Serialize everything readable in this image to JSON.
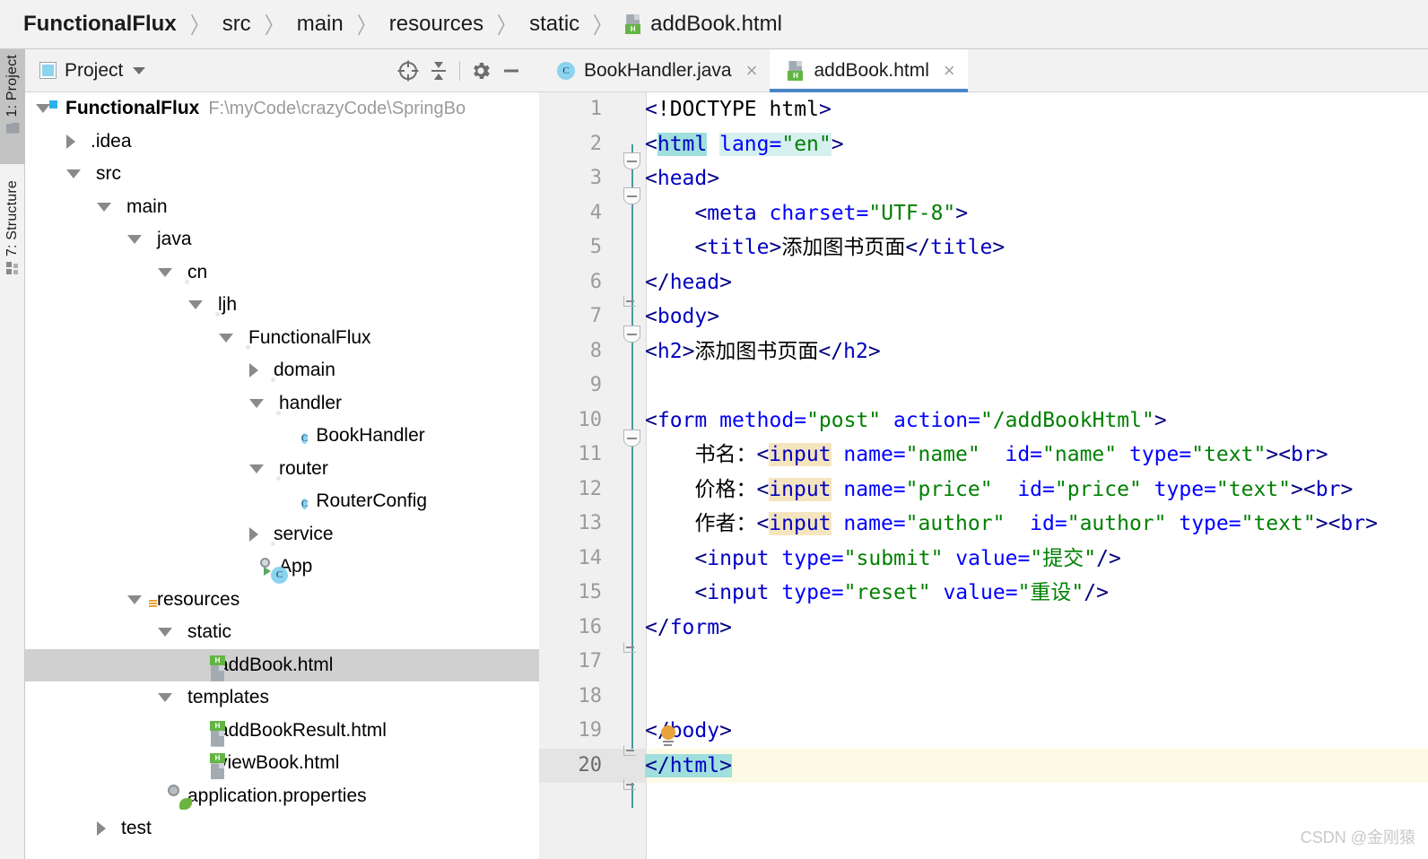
{
  "breadcrumb": {
    "items": [
      "FunctionalFlux",
      "src",
      "main",
      "resources",
      "static"
    ],
    "file": "addBook.html",
    "separator": "〉"
  },
  "left_tool_strip": {
    "tabs": [
      {
        "label": "1: Project",
        "icon": "folder-icon",
        "active": true
      },
      {
        "label": "7: Structure",
        "icon": "structure-icon",
        "active": false
      }
    ]
  },
  "project_panel": {
    "title": "Project",
    "toolbar": {
      "select_opened_file": "crosshair-icon",
      "collapse_all": "collapse-all-icon",
      "settings": "gear-icon",
      "hide": "minus-icon"
    },
    "tree": [
      {
        "depth": 0,
        "twist": "open",
        "icon": "module-folder-icon",
        "label": "FunctionalFlux",
        "bold": true,
        "path": "F:\\myCode\\crazyCode\\SpringBo",
        "selected": false
      },
      {
        "depth": 1,
        "twist": "closed",
        "icon": "folder-icon",
        "label": ".idea",
        "bold": false,
        "path": "",
        "selected": false
      },
      {
        "depth": 1,
        "twist": "open",
        "icon": "folder-icon",
        "label": "src",
        "bold": false,
        "path": "",
        "selected": false
      },
      {
        "depth": 2,
        "twist": "open",
        "icon": "folder-icon",
        "label": "main",
        "bold": false,
        "path": "",
        "selected": false
      },
      {
        "depth": 3,
        "twist": "open",
        "icon": "source-folder-icon",
        "label": "java",
        "bold": false,
        "path": "",
        "selected": false
      },
      {
        "depth": 4,
        "twist": "open",
        "icon": "package-icon",
        "label": "cn",
        "bold": false,
        "path": "",
        "selected": false
      },
      {
        "depth": 5,
        "twist": "open",
        "icon": "package-icon",
        "label": "ljh",
        "bold": false,
        "path": "",
        "selected": false
      },
      {
        "depth": 6,
        "twist": "open",
        "icon": "package-icon",
        "label": "FunctionalFlux",
        "bold": false,
        "path": "",
        "selected": false
      },
      {
        "depth": 7,
        "twist": "closed",
        "icon": "package-icon",
        "label": "domain",
        "bold": false,
        "path": "",
        "selected": false
      },
      {
        "depth": 7,
        "twist": "open",
        "icon": "package-icon",
        "label": "handler",
        "bold": false,
        "path": "",
        "selected": false
      },
      {
        "depth": 8,
        "twist": "none",
        "icon": "java-class-icon",
        "label": "BookHandler",
        "bold": false,
        "path": "",
        "selected": false
      },
      {
        "depth": 7,
        "twist": "open",
        "icon": "package-icon",
        "label": "router",
        "bold": false,
        "path": "",
        "selected": false
      },
      {
        "depth": 8,
        "twist": "none",
        "icon": "java-class-icon",
        "label": "RouterConfig",
        "bold": false,
        "path": "",
        "selected": false
      },
      {
        "depth": 7,
        "twist": "closed",
        "icon": "package-icon",
        "label": "service",
        "bold": false,
        "path": "",
        "selected": false
      },
      {
        "depth": 7,
        "twist": "none",
        "icon": "runnable-class-icon",
        "label": "App",
        "bold": false,
        "path": "",
        "selected": false
      },
      {
        "depth": 3,
        "twist": "open",
        "icon": "resources-folder-icon",
        "label": "resources",
        "bold": false,
        "path": "",
        "selected": false
      },
      {
        "depth": 4,
        "twist": "open",
        "icon": "folder-icon",
        "label": "static",
        "bold": false,
        "path": "",
        "selected": false
      },
      {
        "depth": 5,
        "twist": "none",
        "icon": "html-file-icon",
        "label": "addBook.html",
        "bold": false,
        "path": "",
        "selected": true
      },
      {
        "depth": 4,
        "twist": "open",
        "icon": "folder-icon",
        "label": "templates",
        "bold": false,
        "path": "",
        "selected": false
      },
      {
        "depth": 5,
        "twist": "none",
        "icon": "html-file-icon",
        "label": "addBookResult.html",
        "bold": false,
        "path": "",
        "selected": false
      },
      {
        "depth": 5,
        "twist": "none",
        "icon": "html-file-icon",
        "label": "viewBook.html",
        "bold": false,
        "path": "",
        "selected": false
      },
      {
        "depth": 4,
        "twist": "none",
        "icon": "spring-properties-icon",
        "label": "application.properties",
        "bold": false,
        "path": "",
        "selected": false
      },
      {
        "depth": 2,
        "twist": "closed",
        "icon": "folder-icon",
        "label": "test",
        "bold": false,
        "path": "",
        "selected": false
      }
    ]
  },
  "editor": {
    "tabs": [
      {
        "label": "BookHandler.java",
        "icon": "java-class-icon",
        "active": false,
        "close": "×"
      },
      {
        "label": "addBook.html",
        "icon": "html-file-icon",
        "active": true,
        "close": "×"
      }
    ],
    "language": "HTML",
    "total_lines": 20,
    "current_line": 20,
    "code_lines": [
      {
        "n": 1,
        "text": "<!DOCTYPE html>"
      },
      {
        "n": 2,
        "text": "<html lang=\"en\">"
      },
      {
        "n": 3,
        "text": "<head>"
      },
      {
        "n": 4,
        "text": "    <meta charset=\"UTF-8\">"
      },
      {
        "n": 5,
        "text": "    <title>添加图书页面</title>"
      },
      {
        "n": 6,
        "text": "</head>"
      },
      {
        "n": 7,
        "text": "<body>"
      },
      {
        "n": 8,
        "text": "<h2>添加图书页面</h2>"
      },
      {
        "n": 9,
        "text": ""
      },
      {
        "n": 10,
        "text": "<form method=\"post\" action=\"/addBookHtml\">"
      },
      {
        "n": 11,
        "text": "    书名：<input name=\"name\"  id=\"name\" type=\"text\"><br>"
      },
      {
        "n": 12,
        "text": "    价格：<input name=\"price\"  id=\"price\" type=\"text\"><br>"
      },
      {
        "n": 13,
        "text": "    作者：<input name=\"author\"  id=\"author\" type=\"text\"><br>"
      },
      {
        "n": 14,
        "text": "    <input type=\"submit\" value=\"提交\"/>"
      },
      {
        "n": 15,
        "text": "    <input type=\"reset\" value=\"重设\"/>"
      },
      {
        "n": 16,
        "text": "</form>"
      },
      {
        "n": 17,
        "text": ""
      },
      {
        "n": 18,
        "text": ""
      },
      {
        "n": 19,
        "text": "</body>"
      },
      {
        "n": 20,
        "text": "</html>"
      }
    ]
  },
  "watermark": "CSDN @金刚猿",
  "colors": {
    "tab_underline": "#4a86c8",
    "tag": "#000080",
    "attr": "#0000ff",
    "value": "#008000",
    "identifier_highlight": "#f5e5bf",
    "match_highlight": "#9fdfdd",
    "current_line": "#fcfae4",
    "selection": "#d0d0d0"
  }
}
